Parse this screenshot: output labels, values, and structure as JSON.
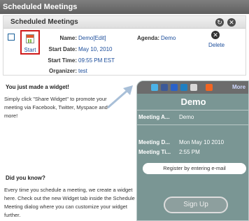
{
  "window": {
    "title": "Scheduled Meetings"
  },
  "panel": {
    "title": "Scheduled Meetings"
  },
  "meeting": {
    "start_label": "Start",
    "name_label": "Name:",
    "name_value": "Demo[Edit]",
    "start_date_label": "Start Date:",
    "start_date_value": "May 10, 2010",
    "start_time_label": "Start Time:",
    "start_time_value": "09:55 PM EST",
    "organizer_label": "Organizer:",
    "organizer_value": "test",
    "agenda_label": "Agenda:",
    "agenda_value": "Demo",
    "delete_label": "Delete"
  },
  "info": {
    "widget_heading": "You just made a widget!",
    "widget_text": "Simply click \"Share Widget\" to promote your meeting via Facebook, Twitter, Myspace and more!",
    "know_heading": "Did you know?",
    "know_text": "Every time you schedule a meeting, we create a widget here. Check out the new Widget tab inside the Schedule Meeting dialog where you can customize your widget further."
  },
  "widget": {
    "share_more": "More",
    "title": "Demo",
    "rows": [
      {
        "label": "Meeting A...",
        "value": "Demo"
      },
      {
        "label": "Meeting D...",
        "value": "Mon May 10 2010"
      },
      {
        "label": "Meeting Ti...",
        "value": "2:55 PM"
      }
    ],
    "register_label": "Register by entering e-mail",
    "signup_label": "Sign Up"
  },
  "colors": {
    "title_bar": "#6b6b6b",
    "highlight_border": "#d01b1b",
    "link": "#1a4c9a",
    "widget_bg": "#7a9694"
  }
}
